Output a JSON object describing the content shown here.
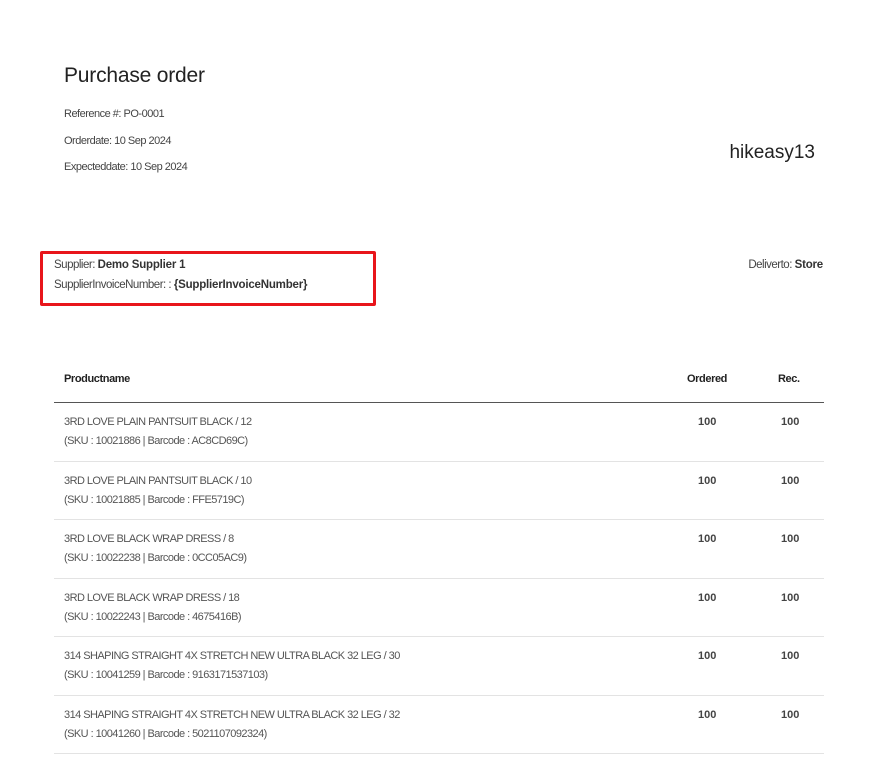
{
  "header": {
    "title": "Purchase order",
    "reference": "Reference #: PO-0001",
    "order_date": "Orderdate: 10 Sep 2024",
    "expected_date": "Expecteddate: 10 Sep 2024",
    "company": "hikeasy13"
  },
  "supplier": {
    "label": "Supplier:",
    "name": "Demo Supplier 1",
    "invoice_label": "SupplierInvoiceNumber: :",
    "invoice_value": "{SupplierInvoiceNumber}",
    "highlight_color": "#e8151b"
  },
  "deliver": {
    "label": "Deliverto:",
    "value": "Store"
  },
  "table": {
    "columns": {
      "name": "Productname",
      "ordered": "Ordered",
      "received": "Rec."
    },
    "rows": [
      {
        "name": "3RD LOVE PLAIN PANTSUIT BLACK / 12",
        "sku": "(SKU : 10021886 | Barcode : AC8CD69C)",
        "ordered": "100",
        "received": "100"
      },
      {
        "name": "3RD LOVE PLAIN PANTSUIT BLACK / 10",
        "sku": "(SKU : 10021885 | Barcode : FFE5719C)",
        "ordered": "100",
        "received": "100"
      },
      {
        "name": "3RD LOVE BLACK WRAP DRESS / 8",
        "sku": "(SKU : 10022238 | Barcode : 0CC05AC9)",
        "ordered": "100",
        "received": "100"
      },
      {
        "name": "3RD LOVE BLACK WRAP DRESS / 18",
        "sku": "(SKU : 10022243 | Barcode : 4675416B)",
        "ordered": "100",
        "received": "100"
      },
      {
        "name": "314 SHAPING STRAIGHT 4X STRETCH NEW ULTRA BLACK 32 LEG / 30",
        "sku": "(SKU : 10041259 | Barcode : 9163171537103)",
        "ordered": "100",
        "received": "100"
      },
      {
        "name": "314 SHAPING STRAIGHT 4X STRETCH NEW ULTRA BLACK 32 LEG / 32",
        "sku": "(SKU : 10041260 | Barcode : 5021107092324)",
        "ordered": "100",
        "received": "100"
      }
    ]
  }
}
